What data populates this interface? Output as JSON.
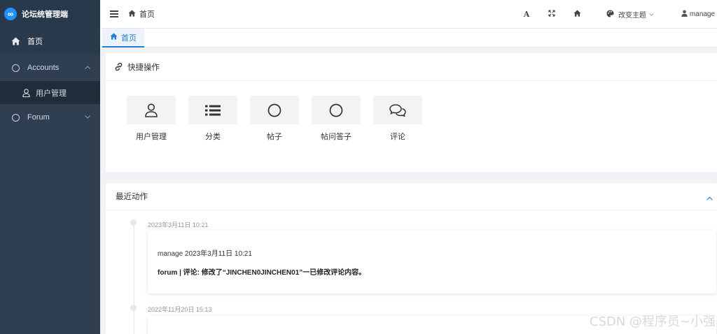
{
  "brand": {
    "title": "论坛统管理端",
    "logo_icon": "infinity-icon",
    "logo_glyph": "∞"
  },
  "sidebar": {
    "items": [
      {
        "label": "首页",
        "icon": "home-icon",
        "active": true
      },
      {
        "label": "Accounts",
        "icon": "circle-icon",
        "expanded": true,
        "children": [
          {
            "label": "用户管理",
            "icon": "user-icon"
          }
        ]
      },
      {
        "label": "Forum",
        "icon": "circle-icon",
        "expanded": false
      }
    ]
  },
  "header": {
    "breadcrumb": "首页",
    "font_btn": "A",
    "theme_label": "改变主题",
    "user_label": "manage"
  },
  "tabs": [
    {
      "label": "首页",
      "active": true
    }
  ],
  "quick": {
    "title": "快捷操作",
    "items": [
      {
        "label": "用户管理",
        "icon": "user-icon"
      },
      {
        "label": "分类",
        "icon": "list-icon"
      },
      {
        "label": "帖子",
        "icon": "circle-icon"
      },
      {
        "label": "帖问答子",
        "icon": "circle-icon"
      },
      {
        "label": "评论",
        "icon": "comments-icon"
      }
    ]
  },
  "activity": {
    "title": "最近动作",
    "entries": [
      {
        "time": "2023年3月11日 10:21",
        "line1": "manage 2023年3月11日 10:21",
        "line2": "forum | 评论: 修改了“JINCHEN0JINCHEN01”一已修改评论内容。"
      },
      {
        "time": "2022年11月20日 15:13"
      }
    ]
  },
  "watermark": "CSDN @程序员~小强",
  "colors": {
    "sidebar_bg": "#2f3e50",
    "accent": "#1e7fd6",
    "page_bg": "#f0f2f5"
  }
}
